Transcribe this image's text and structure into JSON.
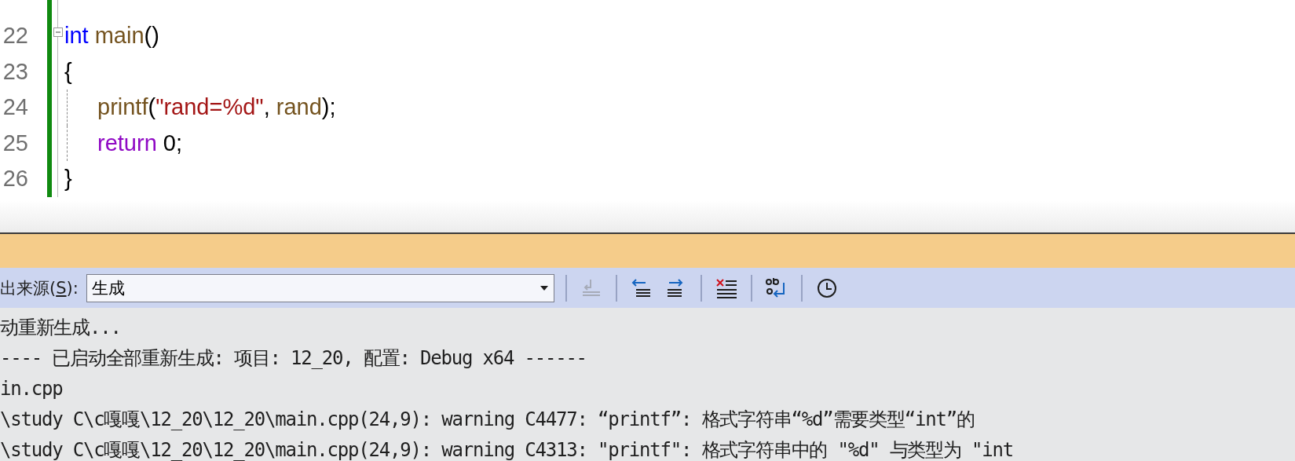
{
  "editor": {
    "lines": [
      {
        "number": "22",
        "fold": true,
        "tokens": [
          {
            "kind": "keyword",
            "text": "int "
          },
          {
            "kind": "function",
            "text": "main"
          },
          {
            "kind": "plain",
            "text": "()"
          }
        ]
      },
      {
        "number": "23",
        "tokens": [
          {
            "kind": "plain",
            "text": "{"
          }
        ]
      },
      {
        "number": "24",
        "indent": true,
        "tokens": [
          {
            "kind": "function",
            "text": "printf"
          },
          {
            "kind": "plain",
            "text": "("
          },
          {
            "kind": "string",
            "text": "\"rand=%d\""
          },
          {
            "kind": "plain",
            "text": ", "
          },
          {
            "kind": "function",
            "text": "rand"
          },
          {
            "kind": "plain",
            "text": ");"
          }
        ]
      },
      {
        "number": "25",
        "indent": true,
        "tokens": [
          {
            "kind": "control",
            "text": "return"
          },
          {
            "kind": "plain",
            "text": " 0;"
          }
        ]
      },
      {
        "number": "26",
        "tokens": [
          {
            "kind": "plain",
            "text": "}"
          }
        ]
      }
    ]
  },
  "output": {
    "source_label": {
      "before": "出来源(",
      "key": "S",
      "after": "):"
    },
    "source_value": "生成",
    "tools": [
      {
        "kind": "goto",
        "disabled": true
      },
      {
        "kind": "prev",
        "disabled": false
      },
      {
        "kind": "next",
        "disabled": false
      },
      {
        "kind": "clear",
        "disabled": false
      },
      {
        "kind": "wrap",
        "disabled": false
      },
      {
        "kind": "clock",
        "disabled": false
      }
    ],
    "lines": [
      "动重新生成...",
      "---- 已启动全部重新生成: 项目: 12_20, 配置: Debug x64 ------",
      "in.cpp",
      "\\study C\\c嘎嘎\\12_20\\12_20\\main.cpp(24,9): warning C4477: “printf”: 格式字符串“%d”需要类型“int”的",
      "\\study C\\c嘎嘎\\12_20\\12_20\\main.cpp(24,9): warning C4313: \"printf\": 格式字符串中的 \"%d\" 与类型为 \"int"
    ]
  }
}
